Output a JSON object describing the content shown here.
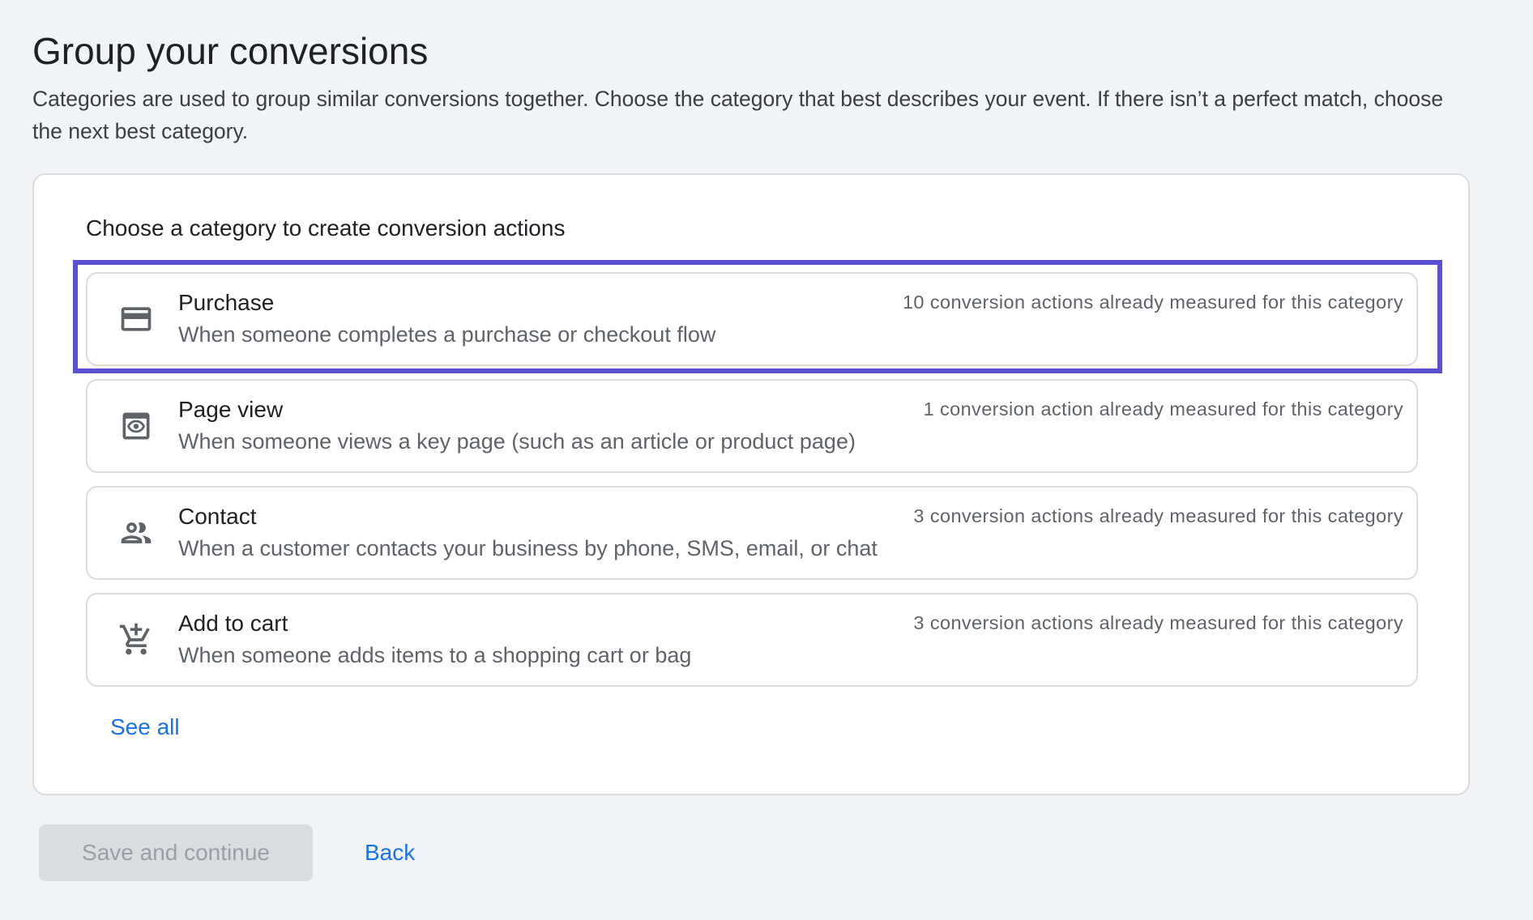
{
  "header": {
    "title": "Group your conversions",
    "description": "Categories are used to group similar conversions together. Choose the category that best describes your event. If there isn’t a perfect match, choose the next best category."
  },
  "card": {
    "heading": "Choose a category to create conversion actions",
    "options": [
      {
        "title": "Purchase",
        "description": "When someone completes a purchase or checkout flow",
        "count": "10 conversion actions already measured for this category",
        "icon": "credit-card-icon",
        "selected": true
      },
      {
        "title": "Page view",
        "description": "When someone views a key page (such as an article or product page)",
        "count": "1 conversion action already measured for this category",
        "icon": "page-view-icon",
        "selected": false
      },
      {
        "title": "Contact",
        "description": "When a customer contacts your business by phone, SMS, email, or chat",
        "count": "3 conversion actions already measured for this category",
        "icon": "people-icon",
        "selected": false
      },
      {
        "title": "Add to cart",
        "description": "When someone adds items to a shopping cart or bag",
        "count": "3 conversion actions already measured for this category",
        "icon": "add-shopping-cart-icon",
        "selected": false
      }
    ],
    "see_all_label": "See all"
  },
  "footer": {
    "save_label": "Save and continue",
    "back_label": "Back"
  },
  "colors": {
    "accent": "#1a73e8",
    "selection_outline": "#5b4fd4",
    "background": "#f1f3f4"
  }
}
